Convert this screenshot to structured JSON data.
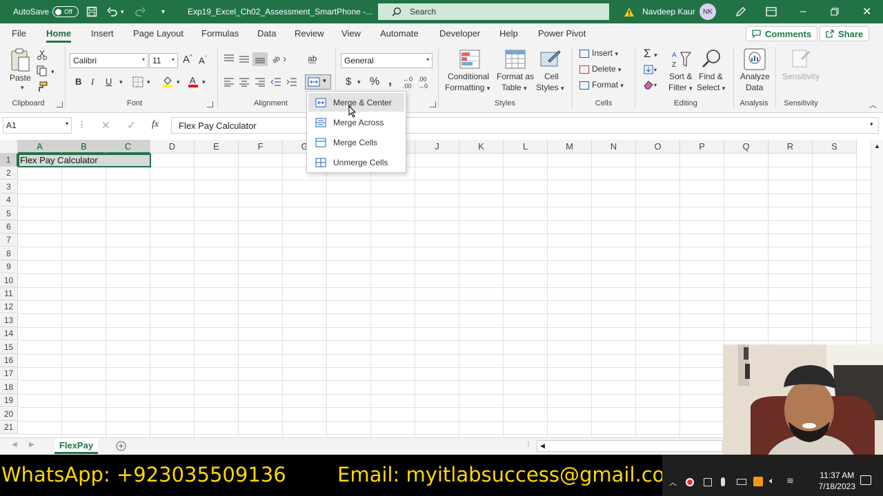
{
  "titlebar": {
    "autosave_label": "AutoSave",
    "autosave_state": "Off",
    "file_name": "Exp19_Excel_Ch02_Assessment_SmartPhone  -...",
    "search_placeholder": "Search",
    "user_name": "Navdeep Kaur",
    "user_initials": "NK"
  },
  "ribbon_tabs": [
    "File",
    "Home",
    "Insert",
    "Page Layout",
    "Formulas",
    "Data",
    "Review",
    "View",
    "Automate",
    "Developer",
    "Help",
    "Power Pivot"
  ],
  "actions": {
    "comments": "Comments",
    "share": "Share"
  },
  "ribbon": {
    "clipboard": {
      "paste": "Paste",
      "label": "Clipboard"
    },
    "font": {
      "name": "Calibri",
      "size": "11",
      "label": "Font",
      "fill_color": "#ffff00",
      "font_color": "#e81123"
    },
    "alignment": {
      "label": "Alignment"
    },
    "number": {
      "format": "General"
    },
    "styles": {
      "conditional_1": "Conditional",
      "conditional_2": "Formatting",
      "format_as_1": "Format as",
      "format_as_2": "Table",
      "cell_1": "Cell",
      "cell_2": "Styles",
      "label": "Styles"
    },
    "cells": {
      "insert": "Insert",
      "delete": "Delete",
      "format": "Format",
      "label": "Cells"
    },
    "editing": {
      "sort_1": "Sort &",
      "sort_2": "Filter",
      "find_1": "Find &",
      "find_2": "Select",
      "label": "Editing"
    },
    "analysis": {
      "btn_1": "Analyze",
      "btn_2": "Data",
      "label": "Analysis"
    },
    "sensitivity": {
      "btn": "Sensitivity",
      "label": "Sensitivity"
    }
  },
  "formula_bar": {
    "name_box": "A1",
    "fx": "fx",
    "content": "Flex Pay Calculator"
  },
  "grid": {
    "columns": [
      "A",
      "B",
      "C",
      "D",
      "E",
      "F",
      "G",
      "H",
      "I",
      "J",
      "K",
      "L",
      "M",
      "N",
      "O",
      "P",
      "Q",
      "R",
      "S"
    ],
    "rows": [
      "1",
      "2",
      "3",
      "4",
      "5",
      "6",
      "7",
      "8",
      "9",
      "10",
      "11",
      "12",
      "13",
      "14",
      "15",
      "16",
      "17",
      "18",
      "19",
      "20",
      "21"
    ],
    "a1_value": "Flex Pay Calculator"
  },
  "merge_menu": {
    "items": [
      "Merge & Center",
      "Merge Across",
      "Merge Cells",
      "Unmerge Cells"
    ]
  },
  "sheet_tabs": {
    "active": "FlexPay"
  },
  "banner": {
    "whatsapp": "WhatsApp: +923035509136",
    "email": "Email: myitlabsuccess@gmail.com"
  },
  "taskbar": {
    "time": "11:37 AM",
    "date": "7/18/2023"
  },
  "colors": {
    "excel_green": "#217346",
    "banner_text": "#ffd700"
  }
}
